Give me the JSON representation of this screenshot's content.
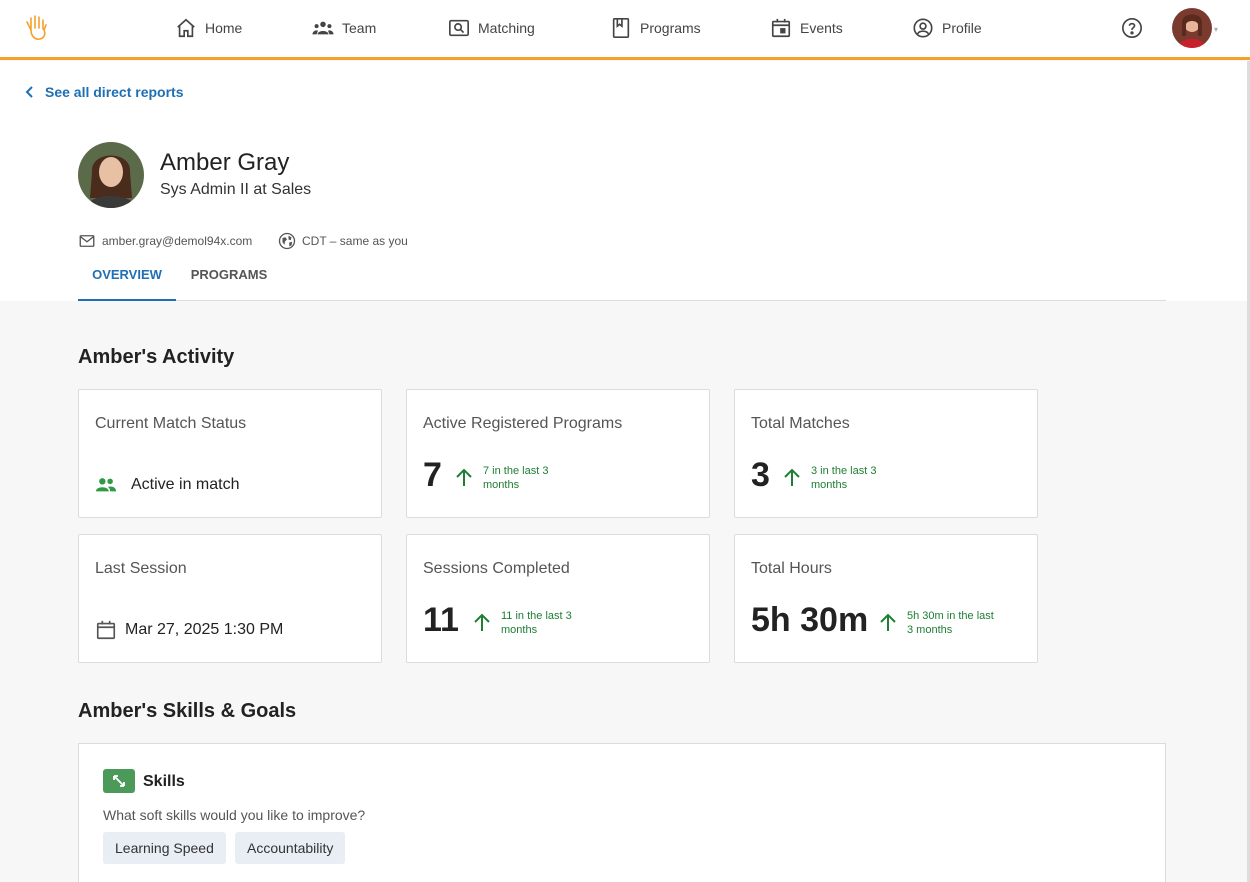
{
  "nav": {
    "items": [
      {
        "label": "Home",
        "icon": "home-icon"
      },
      {
        "label": "Team",
        "icon": "team-icon"
      },
      {
        "label": "Matching",
        "icon": "matching-icon"
      },
      {
        "label": "Programs",
        "icon": "programs-icon"
      },
      {
        "label": "Events",
        "icon": "events-icon"
      },
      {
        "label": "Profile",
        "icon": "profile-icon"
      }
    ],
    "accent_color": "#f5a02a"
  },
  "back_link": "See all direct reports",
  "profile": {
    "name": "Amber Gray",
    "role": "Sys Admin II at Sales",
    "email": "amber.gray@demol94x.com",
    "timezone": "CDT – same as you"
  },
  "tabs": [
    "OVERVIEW",
    "PROGRAMS"
  ],
  "activity": {
    "title": "Amber's Activity",
    "current_match": {
      "title": "Current Match Status",
      "status": "Active in match"
    },
    "programs": {
      "title": "Active Registered Programs",
      "value": "7",
      "trend": "7 in the last 3 months"
    },
    "matches": {
      "title": "Total Matches",
      "value": "3",
      "trend": "3 in the last 3 months"
    },
    "last_session": {
      "title": "Last Session",
      "value": "Mar 27, 2025 1:30 PM"
    },
    "sessions": {
      "title": "Sessions Completed",
      "value": "11",
      "trend": "11 in the last 3 months"
    },
    "hours": {
      "title": "Total Hours",
      "value": "5h 30m",
      "trend": "5h 30m in the last 3 months"
    }
  },
  "skills_goals": {
    "title": "Amber's Skills & Goals",
    "skills_label": "Skills",
    "question": "What soft skills would you like to improve?",
    "chips": [
      "Learning Speed",
      "Accountability"
    ]
  }
}
